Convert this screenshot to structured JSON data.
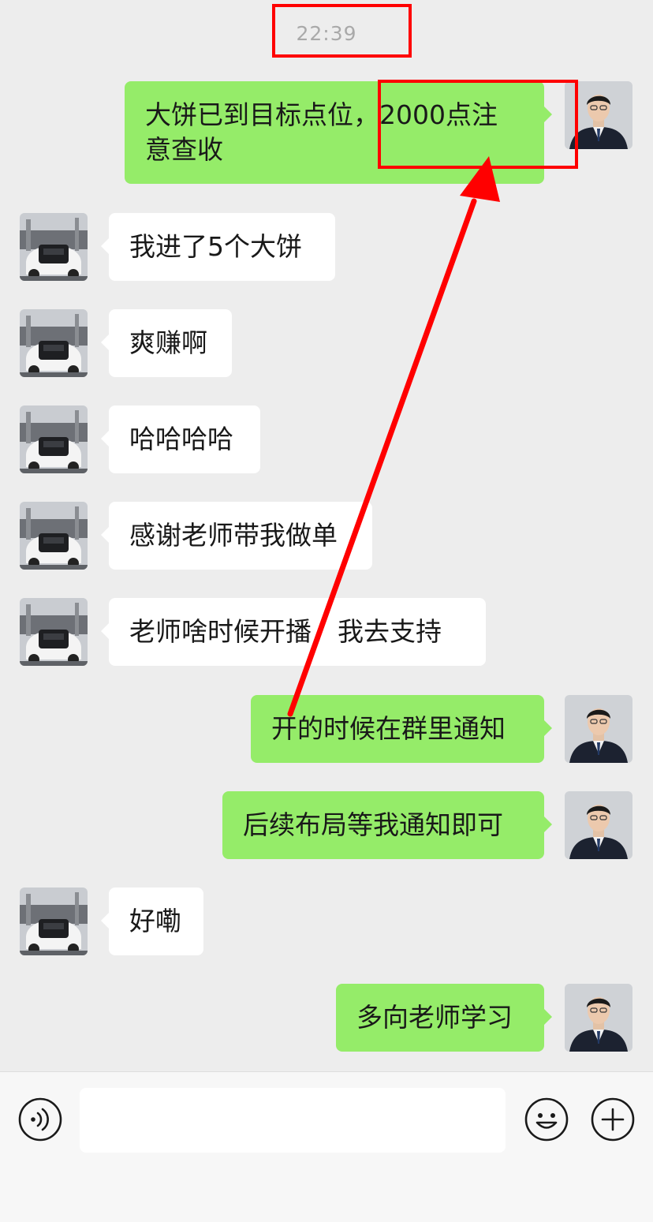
{
  "timestamp": "22:39",
  "messages": [
    {
      "side": "out",
      "lines": [
        "大饼已到目标点位，2000点注",
        "意查收"
      ]
    },
    {
      "side": "in",
      "text": "我进了5个大饼"
    },
    {
      "side": "in",
      "text": "爽赚啊"
    },
    {
      "side": "in",
      "text": "哈哈哈哈"
    },
    {
      "side": "in",
      "text": "感谢老师带我做单"
    },
    {
      "side": "in",
      "text": "老师啥时候开播，我去支持"
    },
    {
      "side": "out",
      "text": "开的时候在群里通知"
    },
    {
      "side": "out",
      "text": "后续布局等我通知即可"
    },
    {
      "side": "in",
      "text": "好嘞"
    },
    {
      "side": "out",
      "text": "多向老师学习"
    }
  ],
  "input": {
    "value": "",
    "placeholder": ""
  },
  "icons": {
    "voice": "voice-icon",
    "emoji": "emoji-icon",
    "plus": "plus-icon",
    "avatar_self": "man-in-suit-avatar",
    "avatar_other": "car-engine-avatar"
  },
  "colors": {
    "background": "#ededed",
    "outgoing_bubble": "#95ec69",
    "incoming_bubble": "#ffffff",
    "annotation": "#ff0000"
  }
}
